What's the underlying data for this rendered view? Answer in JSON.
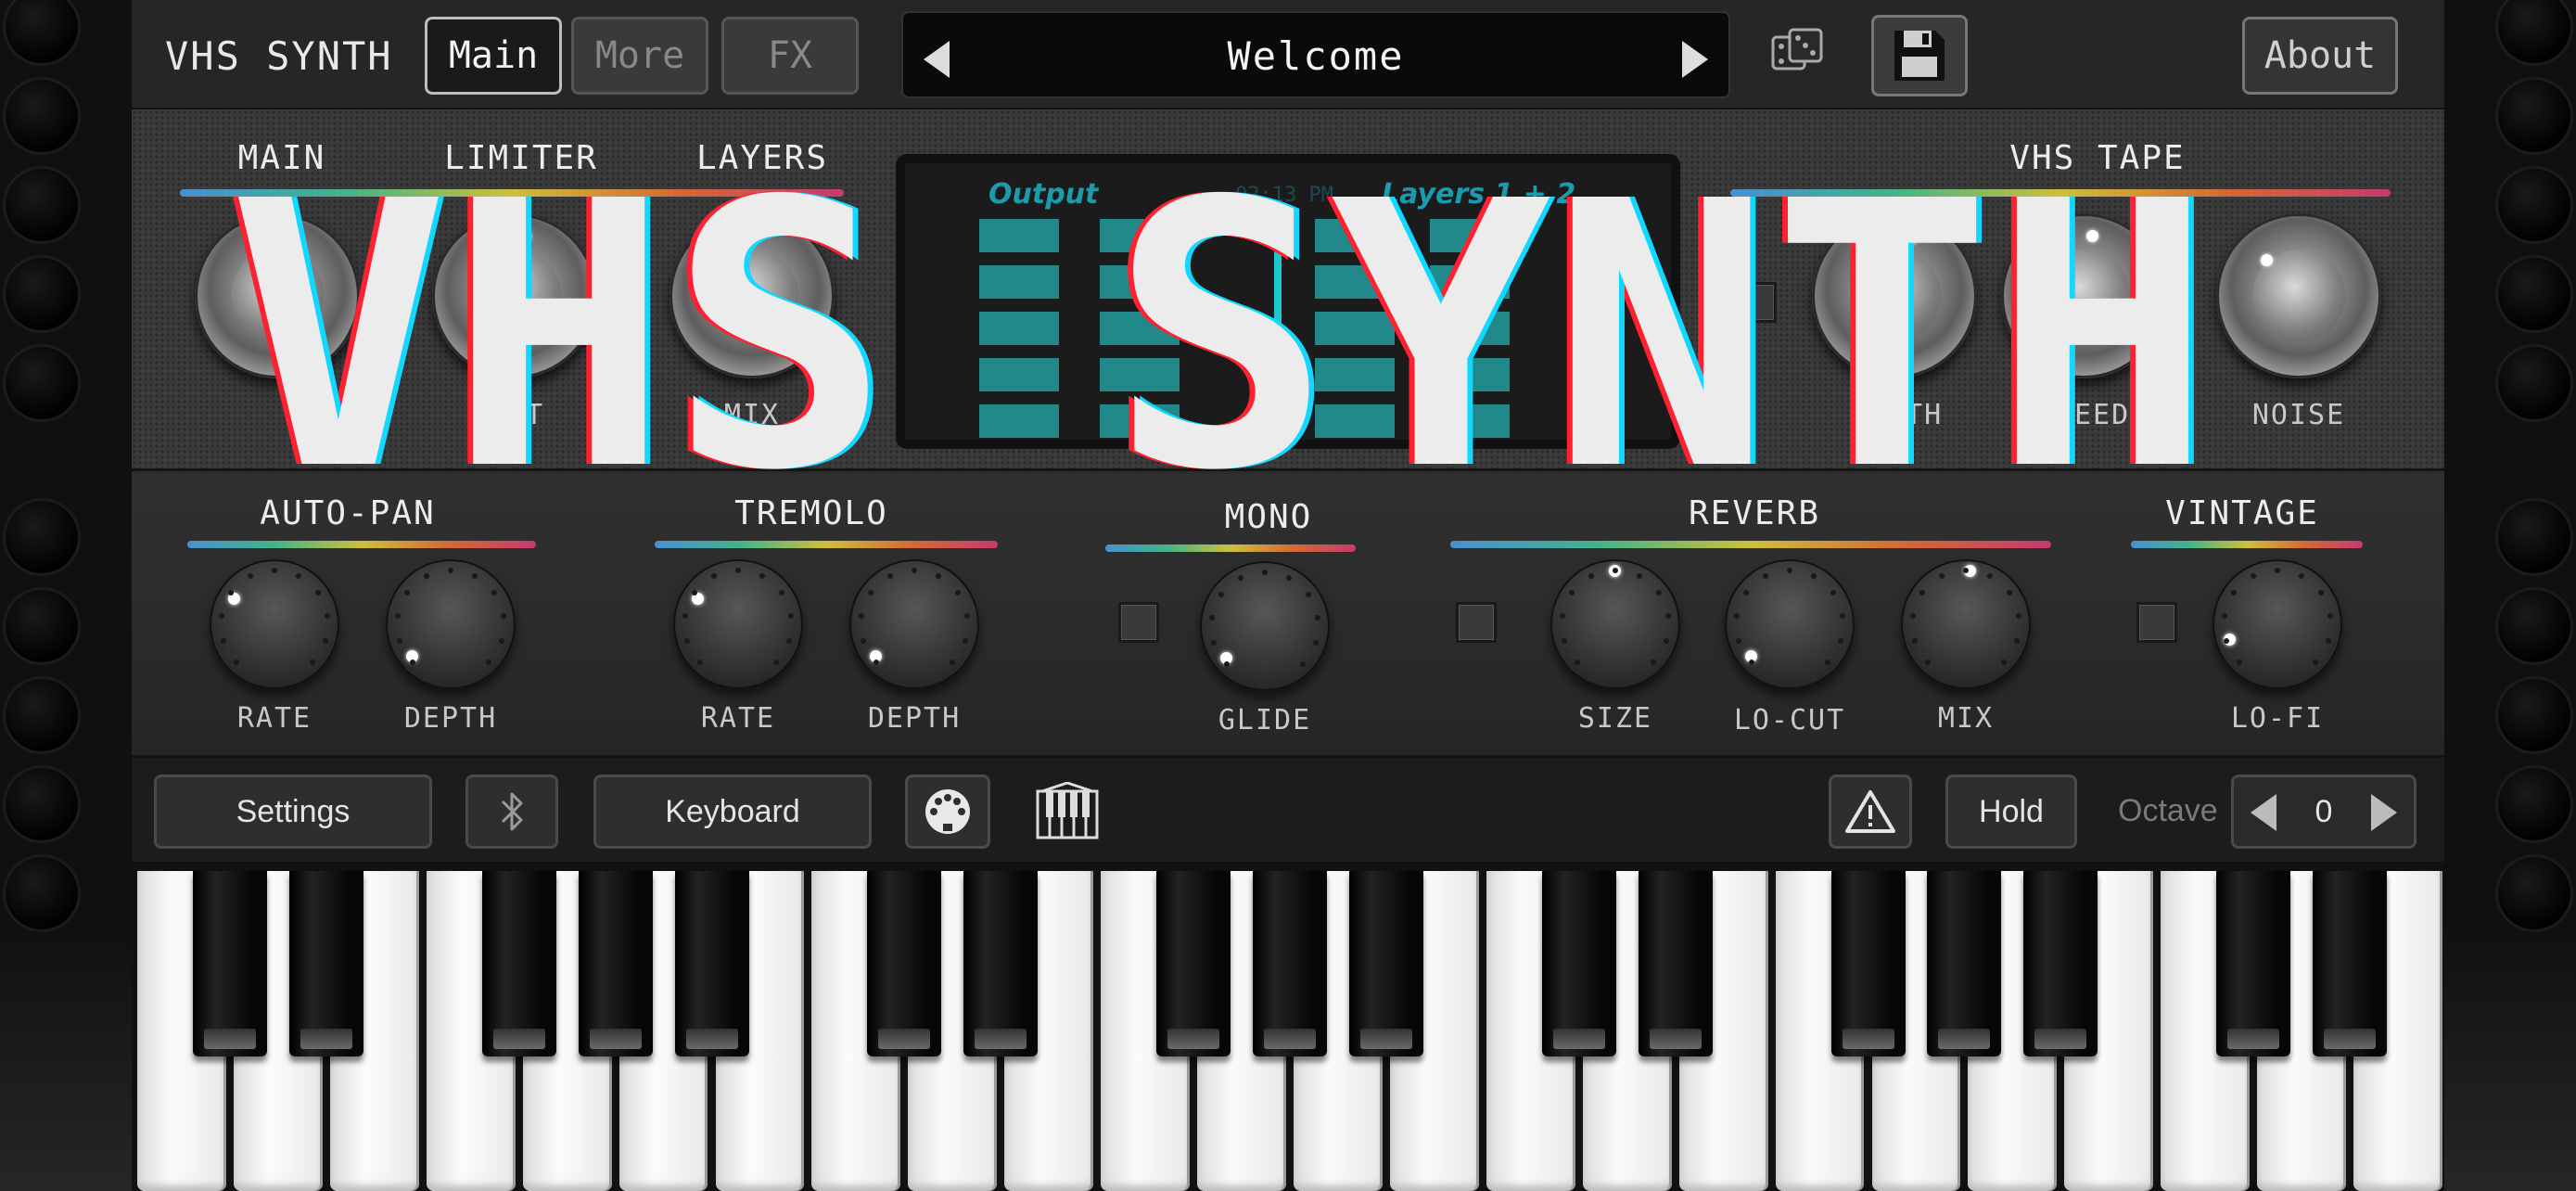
{
  "app": {
    "title": "VHS SYNTH",
    "tabs": [
      {
        "label": "Main",
        "active": true
      },
      {
        "label": "More",
        "active": false
      },
      {
        "label": "FX",
        "active": false
      }
    ],
    "preset": "Welcome",
    "about": "About",
    "icons": {
      "prev": "chevron-left-icon",
      "next": "chevron-right-icon",
      "random": "dice-icon",
      "save": "floppy-disk-icon"
    }
  },
  "upper": {
    "sections": {
      "main": "MAIN",
      "limiter": "LIMITER",
      "layers": "LAYERS",
      "vhs_tape": "VHS TAPE"
    },
    "knob_labels": {
      "limiter": "AMT",
      "layers": "MIX",
      "vhs_depth": "DEPTH",
      "vhs_speed": "SPEED",
      "vhs_noise": "NOISE"
    }
  },
  "screen": {
    "output_label": "Output",
    "layers_label": "Layers 1 + 2",
    "clock": "02:13 PM",
    "color": "#22898a"
  },
  "lower": {
    "autopan": {
      "title": "AUTO-PAN",
      "rate": "RATE",
      "depth": "DEPTH"
    },
    "tremolo": {
      "title": "TREMOLO",
      "rate": "RATE",
      "depth": "DEPTH"
    },
    "mono": {
      "title": "MONO",
      "glide": "GLIDE"
    },
    "reverb": {
      "title": "REVERB",
      "size": "SIZE",
      "locut": "LO-CUT",
      "mix": "MIX"
    },
    "vintage": {
      "title": "VINTAGE",
      "lofi": "LO-FI"
    }
  },
  "bottom": {
    "settings": "Settings",
    "keyboard": "Keyboard",
    "hold": "Hold",
    "octave_label": "Octave",
    "octave_value": "0",
    "icons": {
      "bluetooth": "bluetooth-icon",
      "midi": "midi-port-icon",
      "piano": "piano-icon",
      "warning": "warning-icon"
    }
  },
  "logo": {
    "text": "VHS SYNTH"
  }
}
